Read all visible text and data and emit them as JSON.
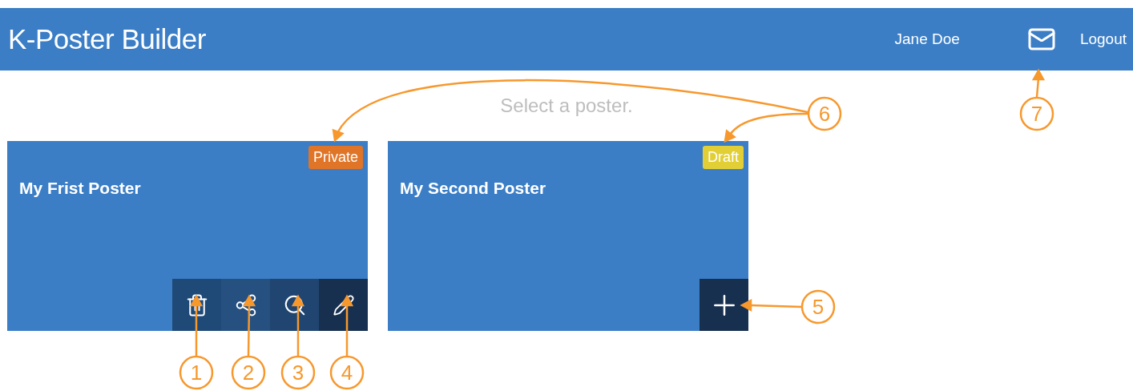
{
  "header": {
    "title": "K-Poster Builder",
    "user": "Jane Doe",
    "logout": "Logout"
  },
  "prompt": "Select a poster.",
  "posters": [
    {
      "title": "My Frist Poster",
      "badge": {
        "label": "Private",
        "color": "#e07427"
      },
      "actions": [
        {
          "kind": "delete"
        },
        {
          "kind": "share"
        },
        {
          "kind": "view"
        },
        {
          "kind": "edit"
        }
      ]
    },
    {
      "title": "My Second Poster",
      "badge": {
        "label": "Draft",
        "color": "#e2cf36"
      },
      "actions": [
        {
          "kind": "add"
        }
      ]
    }
  ],
  "callouts": [
    {
      "label": "1"
    },
    {
      "label": "2"
    },
    {
      "label": "3"
    },
    {
      "label": "4"
    },
    {
      "label": "5"
    },
    {
      "label": "6"
    },
    {
      "label": "7"
    }
  ]
}
